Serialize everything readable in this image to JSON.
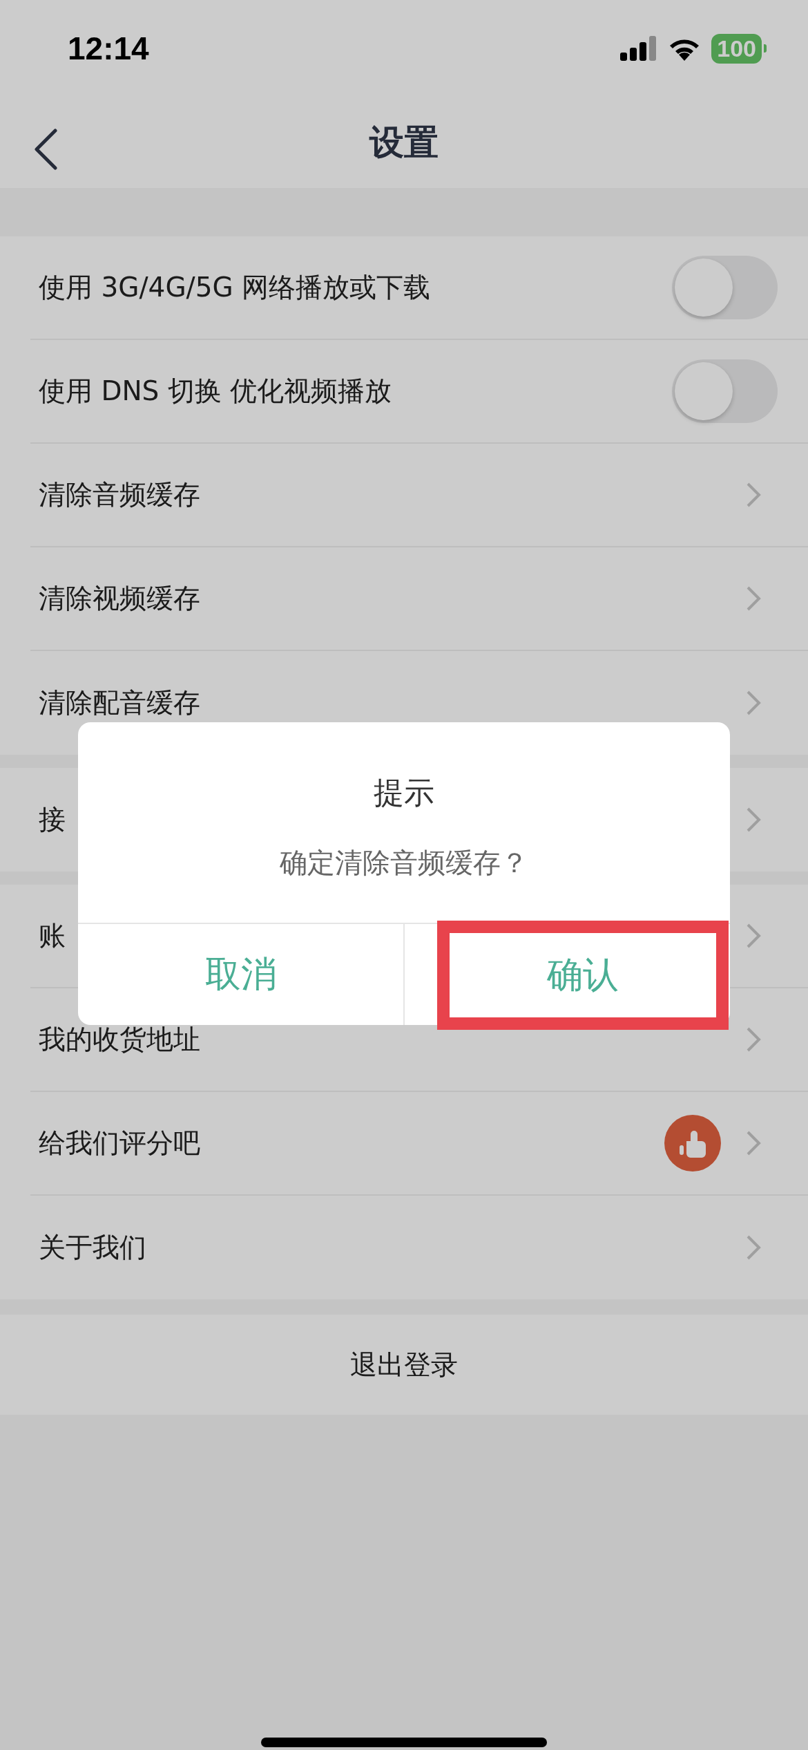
{
  "status_bar": {
    "time": "12:14",
    "battery": "100"
  },
  "nav": {
    "title": "设置"
  },
  "sections": [
    {
      "rows": [
        {
          "kind": "toggle",
          "label": "使用 3G/4G/5G 网络播放或下载",
          "on": false
        },
        {
          "kind": "toggle",
          "label": "使用 DNS 切换 优化视频播放",
          "on": false
        },
        {
          "kind": "link",
          "label": "清除音频缓存"
        },
        {
          "kind": "link",
          "label": "清除视频缓存"
        },
        {
          "kind": "link",
          "label": "清除配音缓存"
        }
      ]
    },
    {
      "rows": [
        {
          "kind": "link",
          "label": "接"
        }
      ]
    },
    {
      "rows": [
        {
          "kind": "link",
          "label": "账"
        },
        {
          "kind": "link",
          "label": "我的收货地址"
        },
        {
          "kind": "rate",
          "label": "给我们评分吧"
        },
        {
          "kind": "link",
          "label": "关于我们"
        }
      ]
    }
  ],
  "logout": "退出登录",
  "dialog": {
    "title": "提示",
    "message": "确定清除音频缓存？",
    "buttons": [
      {
        "label": "取消",
        "highlighted": false
      },
      {
        "label": "确认",
        "highlighted": true
      }
    ]
  }
}
